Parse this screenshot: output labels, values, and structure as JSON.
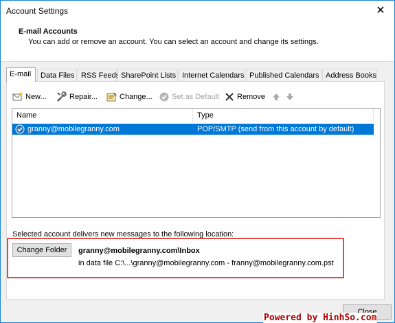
{
  "window": {
    "title": "Account Settings",
    "close_glyph": "✕"
  },
  "header": {
    "title": "E-mail Accounts",
    "subtitle": "You can add or remove an account. You can select an account and change its settings."
  },
  "tabs": [
    {
      "label": "E-mail",
      "active": true
    },
    {
      "label": "Data Files"
    },
    {
      "label": "RSS Feeds"
    },
    {
      "label": "SharePoint Lists"
    },
    {
      "label": "Internet Calendars"
    },
    {
      "label": "Published Calendars"
    },
    {
      "label": "Address Books"
    }
  ],
  "toolbar": {
    "new_label": "New...",
    "repair_label": "Repair...",
    "change_label": "Change...",
    "set_default_label": "Set as Default",
    "remove_label": "Remove",
    "up_icon": "arrow-up-icon",
    "down_icon": "arrow-down-icon"
  },
  "accounts": {
    "columns": [
      "Name",
      "Type"
    ],
    "rows": [
      {
        "name": "granny@mobilegranny.com",
        "type": "POP/SMTP (send from this account by default)",
        "selected": true
      }
    ]
  },
  "delivery": {
    "label": "Selected account delivers new messages to the following location:",
    "change_folder_label": "Change Folder",
    "folder_path": "granny@mobilegranny.com\\Inbox",
    "data_file": "in data file C:\\...\\granny@mobilegranny.com - franny@mobilegranny.com.pst"
  },
  "footer": {
    "close_label": "Close"
  },
  "watermark": "Powered by HinhSo.com",
  "colors": {
    "selection": "#0078d7",
    "highlight_border": "#e04a3f",
    "window_border": "#1883d7"
  }
}
